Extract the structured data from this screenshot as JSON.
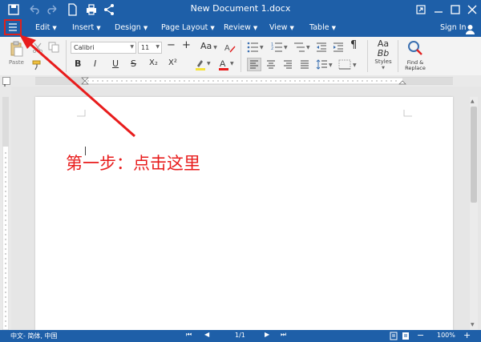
{
  "titlebar": {
    "title": "New Document 1.docx"
  },
  "menubar": {
    "items": [
      "Edit",
      "Insert",
      "Design",
      "Page Layout",
      "Review",
      "View",
      "Table"
    ],
    "signin_label": "Sign In"
  },
  "ribbon": {
    "paste_label": "Paste",
    "font_name": "Calibri",
    "font_size": "11",
    "increase_font_label": "+",
    "decrease_font_label": "−",
    "change_case_label": "Aa",
    "bold_label": "B",
    "italic_label": "I",
    "underline_label": "U",
    "strike_label": "S",
    "subscript_label": "X₂",
    "superscript_label": "X²",
    "paragraph_mark_label": "¶",
    "styles_sample_top": "Aa",
    "styles_sample_bottom": "Bb",
    "styles_label": "Styles",
    "find_replace_label": "Find &\nReplace"
  },
  "document": {
    "annotation": "第一步：点击这里"
  },
  "statusbar": {
    "language": "中文- 简体, 中国",
    "page_indicator": "1/1",
    "zoom_value": "100%"
  },
  "colors": {
    "accent": "#1e5fa8",
    "annotation": "#e81c1c",
    "highlight": "#f5e23a",
    "font_color": "#e81c1c"
  }
}
